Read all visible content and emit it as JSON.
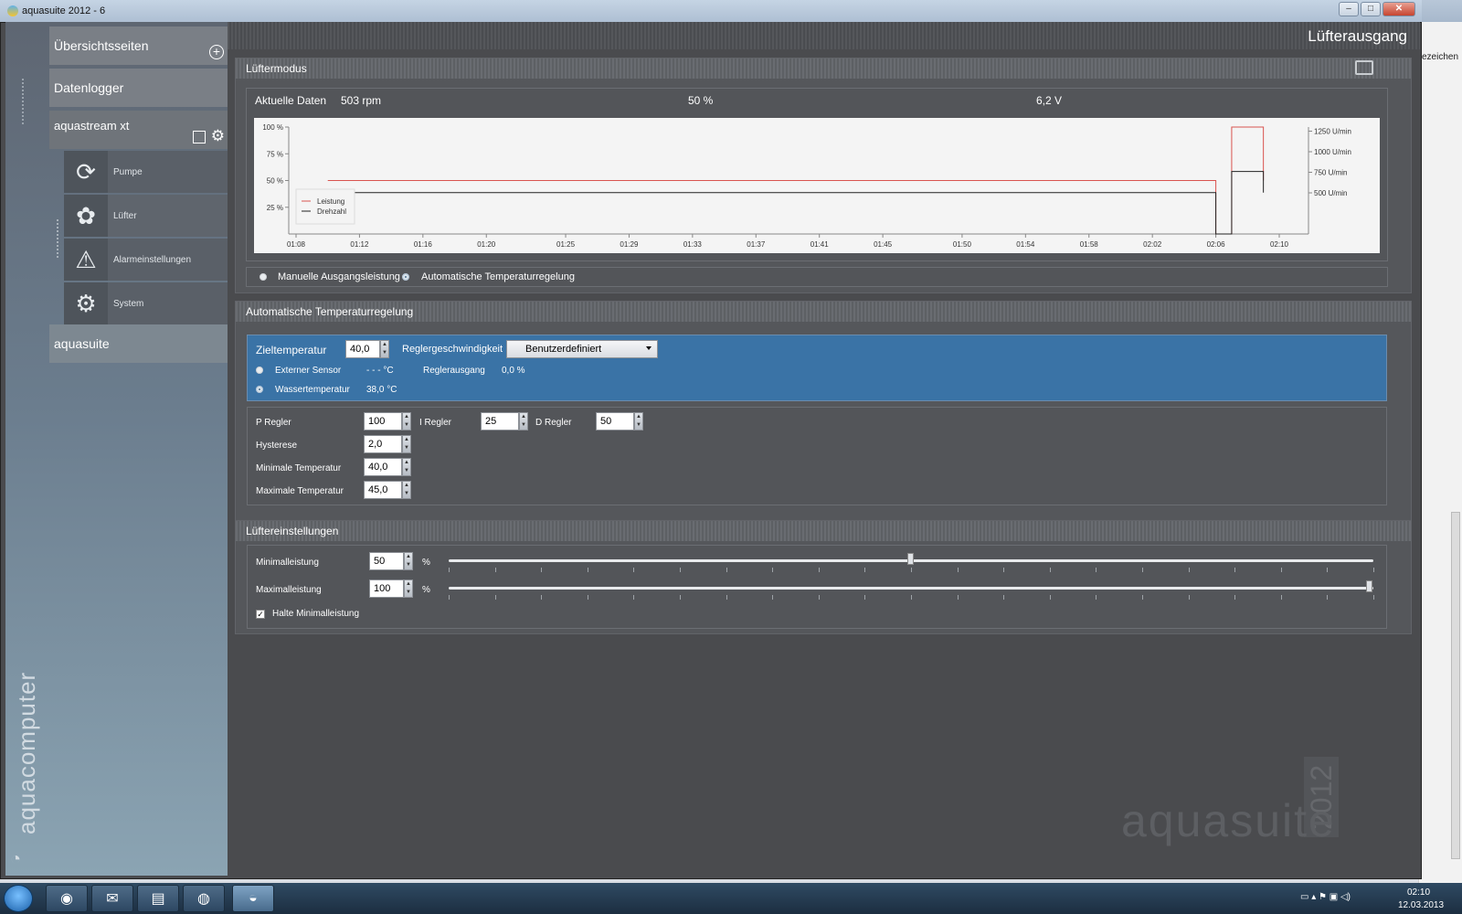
{
  "window": {
    "title": "aquasuite 2012 - 6",
    "browser_right_label": "ezeichen"
  },
  "sidebar": {
    "overview": "Übersichtsseiten",
    "logger": "Datenlogger",
    "device": "aquastream xt",
    "items": [
      {
        "label": "Pumpe",
        "icon": "pump-icon"
      },
      {
        "label": "Lüfter",
        "icon": "fan-icon"
      },
      {
        "label": "Alarmeinstellungen",
        "icon": "alarm-icon"
      },
      {
        "label": "System",
        "icon": "gear-icon"
      }
    ],
    "suite": "aquasuite",
    "brand": "aquacomputer"
  },
  "page": {
    "title": "Lüfterausgang"
  },
  "fan_mode": {
    "header": "Lüftermodus",
    "current_label": "Aktuelle Daten",
    "rpm": "503 rpm",
    "percent": "50 %",
    "voltage": "6,2 V",
    "mode_options": [
      "Manuelle Ausgangsleistung",
      "Automatische Temperaturregelung"
    ],
    "selected_mode": "Automatische Temperaturregelung"
  },
  "chart_data": {
    "type": "line",
    "x": [
      "01:08",
      "01:12",
      "01:16",
      "01:20",
      "01:25",
      "01:29",
      "01:33",
      "01:37",
      "01:41",
      "01:45",
      "01:50",
      "01:54",
      "01:58",
      "02:02",
      "02:06",
      "02:10"
    ],
    "y_left_ticks": [
      "100 %",
      "75 %",
      "50 %",
      "25 %"
    ],
    "y_right_ticks": [
      "1250 U/min",
      "1000 U/min",
      "750 U/min",
      "500 U/min"
    ],
    "ylim_left": [
      0,
      100
    ],
    "ylim_right": [
      0,
      1300
    ],
    "series": [
      {
        "name": "Leistung",
        "color": "#d9534f",
        "axis": "left",
        "points": [
          [
            "01:10",
            50
          ],
          [
            "02:06",
            50
          ],
          [
            "02:06",
            0
          ],
          [
            "02:07",
            0
          ],
          [
            "02:07",
            30
          ],
          [
            "02:07",
            30
          ],
          [
            "02:07",
            100
          ],
          [
            "02:09",
            100
          ],
          [
            "02:09",
            50
          ]
        ]
      },
      {
        "name": "Drehzahl",
        "color": "#222222",
        "axis": "right",
        "points": [
          [
            "01:08",
            503
          ],
          [
            "02:06",
            503
          ],
          [
            "02:06",
            0
          ],
          [
            "02:07",
            0
          ],
          [
            "02:07",
            520
          ],
          [
            "02:07",
            760
          ],
          [
            "02:09",
            760
          ],
          [
            "02:09",
            503
          ]
        ]
      }
    ],
    "legend_position": "left-middle",
    "grid": false
  },
  "auto_temp": {
    "header": "Automatische Temperaturregelung",
    "target_label": "Zieltemperatur",
    "target_value": "40,0",
    "speed_label": "Reglergeschwindigkeit",
    "speed_value": "Benutzerdefiniert",
    "sensor_options": [
      {
        "label": "Externer Sensor",
        "value": "- - - °C"
      },
      {
        "label": "Wassertemperatur",
        "value": "38,0 °C"
      }
    ],
    "selected_sensor": "Wassertemperatur",
    "output_label": "Reglerausgang",
    "output_value": "0,0 %",
    "p_label": "P Regler",
    "p_value": "100",
    "i_label": "I Regler",
    "i_value": "25",
    "d_label": "D Regler",
    "d_value": "50",
    "hyst_label": "Hysterese",
    "hyst_value": "2,0",
    "min_label": "Minimale Temperatur",
    "min_value": "40,0",
    "max_label": "Maximale Temperatur",
    "max_value": "45,0"
  },
  "fan_settings": {
    "header": "Lüftereinstellungen",
    "min_label": "Minimalleistung",
    "min_value": "50",
    "min_unit": "%",
    "min_slider": 0.5,
    "max_label": "Maximalleistung",
    "max_value": "100",
    "max_unit": "%",
    "max_slider": 1.0,
    "hold_label": "Halte Minimalleistung",
    "hold_checked": true
  },
  "watermark": {
    "text": "aquasuite",
    "year": "2012"
  },
  "taskbar": {
    "time": "02:10",
    "date": "12.03.2013"
  }
}
